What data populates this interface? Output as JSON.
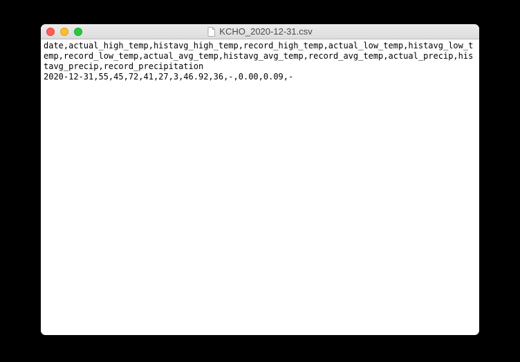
{
  "window": {
    "title": "KCHO_2020-12-31.csv"
  },
  "file": {
    "content": "date,actual_high_temp,histavg_high_temp,record_high_temp,actual_low_temp,histavg_low_temp,record_low_temp,actual_avg_temp,histavg_avg_temp,record_avg_temp,actual_precip,histavg_precip,record_precipitation\n2020-12-31,55,45,72,41,27,3,46.92,36,-,0.00,0.09,-"
  }
}
